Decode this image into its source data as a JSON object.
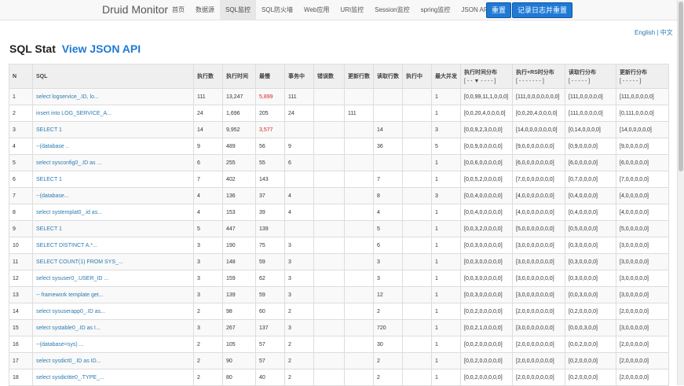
{
  "brand": "Druid Monitor",
  "nav": [
    "首页",
    "数据源",
    "SQL监控",
    "SQL防火墙",
    "Web应用",
    "URI监控",
    "Session监控",
    "spring监控",
    "JSON API"
  ],
  "nav_active": "SQL监控",
  "buttons": {
    "reset": "重置",
    "log_reset": "记录日志并重置"
  },
  "lang": {
    "english": "English",
    "sep": " | ",
    "chinese": "中文"
  },
  "title": {
    "main": "SQL Stat",
    "link": "View JSON API"
  },
  "columns": [
    "N",
    "SQL",
    "执行数",
    "执行时间",
    "最慢",
    "事务中",
    "错误数",
    "更新行数",
    "读取行数",
    "执行中",
    "最大并发",
    "执行时间分布",
    "执行+RS时分布",
    "读取行分布",
    "更新行分布"
  ],
  "column_subs": {
    "exec_dist": "[ - - ▼ - - - - ]",
    "rs_dist": "[ - - - - - - - ]",
    "read_dist": "[ - - - - - ]",
    "update_dist": "[ - - - - - ]"
  },
  "rows": [
    [
      "1",
      "select logservice_.ID, lo...",
      "111",
      "13,247",
      "5,899",
      "111",
      "",
      "",
      "",
      "",
      "1",
      "[0,0,99,11,1,0,0,0]",
      "[111,0,0,0,0,0,0,0]",
      "[111,0,0,0,0,0]",
      "[111,0,0,0,0,0]"
    ],
    [
      "2",
      "insert into LOG_SERVICE_A...",
      "24",
      "1,696",
      "205",
      "24",
      "",
      "111",
      "",
      "",
      "1",
      "[0,0,20,4,0,0,0,0]",
      "[0,0,20,4,0,0,0,0]",
      "[111,0,0,0,0,0]",
      "[0,111,0,0,0,0]"
    ],
    [
      "3",
      "SELECT 1",
      "14",
      "9,952",
      "3,577",
      "",
      "",
      "",
      "14",
      "",
      "3",
      "[0,0,9,2,3,0,0,0]",
      "[14,0,0,0,0,0,0,0]",
      "[0,14,0,0,0,0]",
      "[14,0,0,0,0,0]"
    ],
    [
      "4",
      "--(database ..",
      "9",
      "489",
      "56",
      "9",
      "",
      "",
      "36",
      "",
      "5",
      "[0,0,9,0,0,0,0,0]",
      "[9,0,0,0,0,0,0,0]",
      "[0,9,0,0,0,0]",
      "[9,0,0,0,0,0]"
    ],
    [
      "5",
      "select sysconfig0_.ID as ...",
      "6",
      "255",
      "55",
      "6",
      "",
      "",
      "",
      "",
      "1",
      "[0,0,6,0,0,0,0,0]",
      "[6,0,0,0,0,0,0,0]",
      "[6,0,0,0,0,0]",
      "[6,0,0,0,0,0]"
    ],
    [
      "6",
      "SELECT 1",
      "7",
      "402",
      "143",
      "",
      "",
      "",
      "7",
      "",
      "1",
      "[0,0,5,2,0,0,0,0]",
      "[7,0,0,0,0,0,0,0]",
      "[0,7,0,0,0,0]",
      "[7,0,0,0,0,0]"
    ],
    [
      "7",
      "--(database...",
      "4",
      "136",
      "37",
      "4",
      "",
      "",
      "8",
      "",
      "3",
      "[0,0,4,0,0,0,0,0]",
      "[4,0,0,0,0,0,0,0]",
      "[0,4,0,0,0,0]",
      "[4,0,0,0,0,0]"
    ],
    [
      "8",
      "select systemplat0_.id as...",
      "4",
      "153",
      "39",
      "4",
      "",
      "",
      "4",
      "",
      "1",
      "[0,0,4,0,0,0,0,0]",
      "[4,0,0,0,0,0,0,0]",
      "[0,4,0,0,0,0]",
      "[4,0,0,0,0,0]"
    ],
    [
      "9",
      "SELECT 1",
      "5",
      "447",
      "139",
      "",
      "",
      "",
      "5",
      "",
      "1",
      "[0,0,3,2,0,0,0,0]",
      "[5,0,0,0,0,0,0,0]",
      "[0,5,0,0,0,0]",
      "[5,0,0,0,0,0]"
    ],
    [
      "10",
      "SELECT DISTINCT A.*...",
      "3",
      "190",
      "75",
      "3",
      "",
      "",
      "6",
      "",
      "1",
      "[0,0,3,0,0,0,0,0]",
      "[3,0,0,0,0,0,0,0]",
      "[0,3,0,0,0,0]",
      "[3,0,0,0,0,0]"
    ],
    [
      "11",
      "SELECT COUNT(1) FROM SYS_...",
      "3",
      "148",
      "59",
      "3",
      "",
      "",
      "3",
      "",
      "1",
      "[0,0,3,0,0,0,0,0]",
      "[3,0,0,0,0,0,0,0]",
      "[0,3,0,0,0,0]",
      "[3,0,0,0,0,0]"
    ],
    [
      "12",
      "select sysuser0_.USER_ID ...",
      "3",
      "159",
      "62",
      "3",
      "",
      "",
      "3",
      "",
      "1",
      "[0,0,3,0,0,0,0,0]",
      "[3,0,0,0,0,0,0,0]",
      "[0,3,0,0,0,0]",
      "[3,0,0,0,0,0]"
    ],
    [
      "13",
      "-- framework template get...",
      "3",
      "139",
      "59",
      "3",
      "",
      "",
      "12",
      "",
      "1",
      "[0,0,3,0,0,0,0,0]",
      "[3,0,0,0,0,0,0,0]",
      "[0,0,3,0,0,0]",
      "[3,0,0,0,0,0]"
    ],
    [
      "14",
      "select sysuserapp0_.ID as...",
      "2",
      "98",
      "60",
      "2",
      "",
      "",
      "2",
      "",
      "1",
      "[0,0,2,0,0,0,0,0]",
      "[2,0,0,0,0,0,0,0]",
      "[0,2,0,0,0,0]",
      "[2,0,0,0,0,0]"
    ],
    [
      "15",
      "select systable0_.ID as I...",
      "3",
      "267",
      "137",
      "3",
      "",
      "",
      "720",
      "",
      "1",
      "[0,0,2,1,0,0,0,0]",
      "[3,0,0,0,0,0,0,0]",
      "[0,0,0,3,0,0]",
      "[3,0,0,0,0,0]"
    ],
    [
      "16",
      "--(database=sys) ...",
      "2",
      "105",
      "57",
      "2",
      "",
      "",
      "30",
      "",
      "1",
      "[0,0,2,0,0,0,0,0]",
      "[2,0,0,0,0,0,0,0]",
      "[0,0,2,0,0,0]",
      "[2,0,0,0,0,0]"
    ],
    [
      "17",
      "select sysdict0_.ID as ID...",
      "2",
      "90",
      "57",
      "2",
      "",
      "",
      "2",
      "",
      "1",
      "[0,0,2,0,0,0,0,0]",
      "[2,0,0,0,0,0,0,0]",
      "[0,2,0,0,0,0]",
      "[2,0,0,0,0,0]"
    ],
    [
      "18",
      "select sysdictite0_.TYPE_...",
      "2",
      "80",
      "40",
      "2",
      "",
      "",
      "2",
      "",
      "1",
      "[0,0,2,0,0,0,0,0]",
      "[2,0,0,0,0,0,0,0]",
      "[0,2,0,0,0,0]",
      "[2,0,0,0,0,0]"
    ]
  ],
  "red_rows": [
    0,
    2
  ],
  "highlight_color": "#e02020"
}
